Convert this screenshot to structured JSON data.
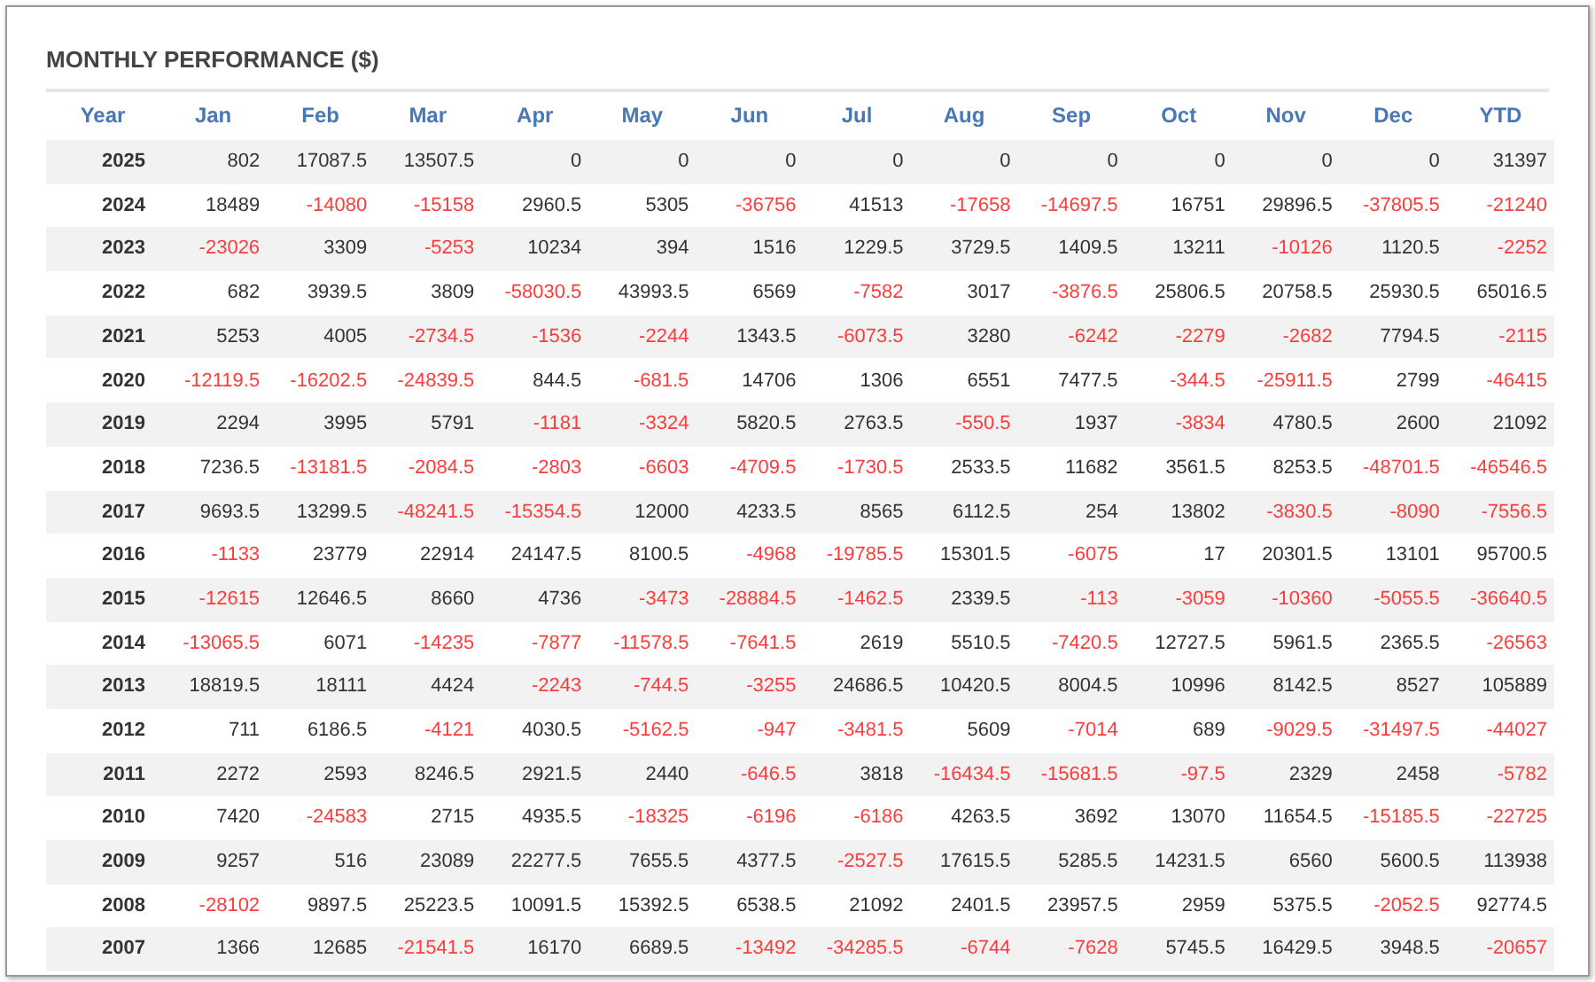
{
  "title": "MONTHLY PERFORMANCE ($)",
  "columns": [
    "Year",
    "Jan",
    "Feb",
    "Mar",
    "Apr",
    "May",
    "Jun",
    "Jul",
    "Aug",
    "Sep",
    "Oct",
    "Nov",
    "Dec",
    "YTD"
  ],
  "rows": [
    {
      "year": "2025",
      "cells": [
        {
          "value": "802",
          "negative": false
        },
        {
          "value": "17087.5",
          "negative": false
        },
        {
          "value": "13507.5",
          "negative": false
        },
        {
          "value": "0",
          "negative": false
        },
        {
          "value": "0",
          "negative": false
        },
        {
          "value": "0",
          "negative": false
        },
        {
          "value": "0",
          "negative": false
        },
        {
          "value": "0",
          "negative": false
        },
        {
          "value": "0",
          "negative": false
        },
        {
          "value": "0",
          "negative": false
        },
        {
          "value": "0",
          "negative": false
        },
        {
          "value": "0",
          "negative": false
        },
        {
          "value": "31397",
          "negative": false
        }
      ]
    },
    {
      "year": "2024",
      "cells": [
        {
          "value": "18489",
          "negative": false
        },
        {
          "value": "-14080",
          "negative": true
        },
        {
          "value": "-15158",
          "negative": true
        },
        {
          "value": "2960.5",
          "negative": false
        },
        {
          "value": "5305",
          "negative": false
        },
        {
          "value": "-36756",
          "negative": true
        },
        {
          "value": "41513",
          "negative": false
        },
        {
          "value": "-17658",
          "negative": true
        },
        {
          "value": "-14697.5",
          "negative": true
        },
        {
          "value": "16751",
          "negative": false
        },
        {
          "value": "29896.5",
          "negative": false
        },
        {
          "value": "-37805.5",
          "negative": true
        },
        {
          "value": "-21240",
          "negative": true
        }
      ]
    },
    {
      "year": "2023",
      "cells": [
        {
          "value": "-23026",
          "negative": true
        },
        {
          "value": "3309",
          "negative": false
        },
        {
          "value": "-5253",
          "negative": true
        },
        {
          "value": "10234",
          "negative": false
        },
        {
          "value": "394",
          "negative": false
        },
        {
          "value": "1516",
          "negative": false
        },
        {
          "value": "1229.5",
          "negative": false
        },
        {
          "value": "3729.5",
          "negative": false
        },
        {
          "value": "1409.5",
          "negative": false
        },
        {
          "value": "13211",
          "negative": false
        },
        {
          "value": "-10126",
          "negative": true
        },
        {
          "value": "1120.5",
          "negative": false
        },
        {
          "value": "-2252",
          "negative": true
        }
      ]
    },
    {
      "year": "2022",
      "cells": [
        {
          "value": "682",
          "negative": false
        },
        {
          "value": "3939.5",
          "negative": false
        },
        {
          "value": "3809",
          "negative": false
        },
        {
          "value": "-58030.5",
          "negative": true
        },
        {
          "value": "43993.5",
          "negative": false
        },
        {
          "value": "6569",
          "negative": false
        },
        {
          "value": "-7582",
          "negative": true
        },
        {
          "value": "3017",
          "negative": false
        },
        {
          "value": "-3876.5",
          "negative": true
        },
        {
          "value": "25806.5",
          "negative": false
        },
        {
          "value": "20758.5",
          "negative": false
        },
        {
          "value": "25930.5",
          "negative": false
        },
        {
          "value": "65016.5",
          "negative": false
        }
      ]
    },
    {
      "year": "2021",
      "cells": [
        {
          "value": "5253",
          "negative": false
        },
        {
          "value": "4005",
          "negative": false
        },
        {
          "value": "-2734.5",
          "negative": true
        },
        {
          "value": "-1536",
          "negative": true
        },
        {
          "value": "-2244",
          "negative": true
        },
        {
          "value": "1343.5",
          "negative": false
        },
        {
          "value": "-6073.5",
          "negative": true
        },
        {
          "value": "3280",
          "negative": false
        },
        {
          "value": "-6242",
          "negative": true
        },
        {
          "value": "-2279",
          "negative": true
        },
        {
          "value": "-2682",
          "negative": true
        },
        {
          "value": "7794.5",
          "negative": false
        },
        {
          "value": "-2115",
          "negative": true
        }
      ]
    },
    {
      "year": "2020",
      "cells": [
        {
          "value": "-12119.5",
          "negative": true
        },
        {
          "value": "-16202.5",
          "negative": true
        },
        {
          "value": "-24839.5",
          "negative": true
        },
        {
          "value": "844.5",
          "negative": false
        },
        {
          "value": "-681.5",
          "negative": true
        },
        {
          "value": "14706",
          "negative": false
        },
        {
          "value": "1306",
          "negative": false
        },
        {
          "value": "6551",
          "negative": false
        },
        {
          "value": "7477.5",
          "negative": false
        },
        {
          "value": "-344.5",
          "negative": true
        },
        {
          "value": "-25911.5",
          "negative": true
        },
        {
          "value": "2799",
          "negative": false
        },
        {
          "value": "-46415",
          "negative": true
        }
      ]
    },
    {
      "year": "2019",
      "cells": [
        {
          "value": "2294",
          "negative": false
        },
        {
          "value": "3995",
          "negative": false
        },
        {
          "value": "5791",
          "negative": false
        },
        {
          "value": "-1181",
          "negative": true
        },
        {
          "value": "-3324",
          "negative": true
        },
        {
          "value": "5820.5",
          "negative": false
        },
        {
          "value": "2763.5",
          "negative": false
        },
        {
          "value": "-550.5",
          "negative": true
        },
        {
          "value": "1937",
          "negative": false
        },
        {
          "value": "-3834",
          "negative": true
        },
        {
          "value": "4780.5",
          "negative": false
        },
        {
          "value": "2600",
          "negative": false
        },
        {
          "value": "21092",
          "negative": false
        }
      ]
    },
    {
      "year": "2018",
      "cells": [
        {
          "value": "7236.5",
          "negative": false
        },
        {
          "value": "-13181.5",
          "negative": true
        },
        {
          "value": "-2084.5",
          "negative": true
        },
        {
          "value": "-2803",
          "negative": true
        },
        {
          "value": "-6603",
          "negative": true
        },
        {
          "value": "-4709.5",
          "negative": true
        },
        {
          "value": "-1730.5",
          "negative": true
        },
        {
          "value": "2533.5",
          "negative": false
        },
        {
          "value": "11682",
          "negative": false
        },
        {
          "value": "3561.5",
          "negative": false
        },
        {
          "value": "8253.5",
          "negative": false
        },
        {
          "value": "-48701.5",
          "negative": true
        },
        {
          "value": "-46546.5",
          "negative": true
        }
      ]
    },
    {
      "year": "2017",
      "cells": [
        {
          "value": "9693.5",
          "negative": false
        },
        {
          "value": "13299.5",
          "negative": false
        },
        {
          "value": "-48241.5",
          "negative": true
        },
        {
          "value": "-15354.5",
          "negative": true
        },
        {
          "value": "12000",
          "negative": false
        },
        {
          "value": "4233.5",
          "negative": false
        },
        {
          "value": "8565",
          "negative": false
        },
        {
          "value": "6112.5",
          "negative": false
        },
        {
          "value": "254",
          "negative": false
        },
        {
          "value": "13802",
          "negative": false
        },
        {
          "value": "-3830.5",
          "negative": true
        },
        {
          "value": "-8090",
          "negative": true
        },
        {
          "value": "-7556.5",
          "negative": true
        }
      ]
    },
    {
      "year": "2016",
      "cells": [
        {
          "value": "-1133",
          "negative": true
        },
        {
          "value": "23779",
          "negative": false
        },
        {
          "value": "22914",
          "negative": false
        },
        {
          "value": "24147.5",
          "negative": false
        },
        {
          "value": "8100.5",
          "negative": false
        },
        {
          "value": "-4968",
          "negative": true
        },
        {
          "value": "-19785.5",
          "negative": true
        },
        {
          "value": "15301.5",
          "negative": false
        },
        {
          "value": "-6075",
          "negative": true
        },
        {
          "value": "17",
          "negative": false
        },
        {
          "value": "20301.5",
          "negative": false
        },
        {
          "value": "13101",
          "negative": false
        },
        {
          "value": "95700.5",
          "negative": false
        }
      ]
    },
    {
      "year": "2015",
      "cells": [
        {
          "value": "-12615",
          "negative": true
        },
        {
          "value": "12646.5",
          "negative": false
        },
        {
          "value": "8660",
          "negative": false
        },
        {
          "value": "4736",
          "negative": false
        },
        {
          "value": "-3473",
          "negative": true
        },
        {
          "value": "-28884.5",
          "negative": true
        },
        {
          "value": "-1462.5",
          "negative": true
        },
        {
          "value": "2339.5",
          "negative": false
        },
        {
          "value": "-113",
          "negative": true
        },
        {
          "value": "-3059",
          "negative": true
        },
        {
          "value": "-10360",
          "negative": true
        },
        {
          "value": "-5055.5",
          "negative": true
        },
        {
          "value": "-36640.5",
          "negative": true
        }
      ]
    },
    {
      "year": "2014",
      "cells": [
        {
          "value": "-13065.5",
          "negative": true
        },
        {
          "value": "6071",
          "negative": false
        },
        {
          "value": "-14235",
          "negative": true
        },
        {
          "value": "-7877",
          "negative": true
        },
        {
          "value": "-11578.5",
          "negative": true
        },
        {
          "value": "-7641.5",
          "negative": true
        },
        {
          "value": "2619",
          "negative": false
        },
        {
          "value": "5510.5",
          "negative": false
        },
        {
          "value": "-7420.5",
          "negative": true
        },
        {
          "value": "12727.5",
          "negative": false
        },
        {
          "value": "5961.5",
          "negative": false
        },
        {
          "value": "2365.5",
          "negative": false
        },
        {
          "value": "-26563",
          "negative": true
        }
      ]
    },
    {
      "year": "2013",
      "cells": [
        {
          "value": "18819.5",
          "negative": false
        },
        {
          "value": "18111",
          "negative": false
        },
        {
          "value": "4424",
          "negative": false
        },
        {
          "value": "-2243",
          "negative": true
        },
        {
          "value": "-744.5",
          "negative": true
        },
        {
          "value": "-3255",
          "negative": true
        },
        {
          "value": "24686.5",
          "negative": false
        },
        {
          "value": "10420.5",
          "negative": false
        },
        {
          "value": "8004.5",
          "negative": false
        },
        {
          "value": "10996",
          "negative": false
        },
        {
          "value": "8142.5",
          "negative": false
        },
        {
          "value": "8527",
          "negative": false
        },
        {
          "value": "105889",
          "negative": false
        }
      ]
    },
    {
      "year": "2012",
      "cells": [
        {
          "value": "711",
          "negative": false
        },
        {
          "value": "6186.5",
          "negative": false
        },
        {
          "value": "-4121",
          "negative": true
        },
        {
          "value": "4030.5",
          "negative": false
        },
        {
          "value": "-5162.5",
          "negative": true
        },
        {
          "value": "-947",
          "negative": true
        },
        {
          "value": "-3481.5",
          "negative": true
        },
        {
          "value": "5609",
          "negative": false
        },
        {
          "value": "-7014",
          "negative": true
        },
        {
          "value": "689",
          "negative": false
        },
        {
          "value": "-9029.5",
          "negative": true
        },
        {
          "value": "-31497.5",
          "negative": true
        },
        {
          "value": "-44027",
          "negative": true
        }
      ]
    },
    {
      "year": "2011",
      "cells": [
        {
          "value": "2272",
          "negative": false
        },
        {
          "value": "2593",
          "negative": false
        },
        {
          "value": "8246.5",
          "negative": false
        },
        {
          "value": "2921.5",
          "negative": false
        },
        {
          "value": "2440",
          "negative": false
        },
        {
          "value": "-646.5",
          "negative": true
        },
        {
          "value": "3818",
          "negative": false
        },
        {
          "value": "-16434.5",
          "negative": true
        },
        {
          "value": "-15681.5",
          "negative": true
        },
        {
          "value": "-97.5",
          "negative": true
        },
        {
          "value": "2329",
          "negative": false
        },
        {
          "value": "2458",
          "negative": false
        },
        {
          "value": "-5782",
          "negative": true
        }
      ]
    },
    {
      "year": "2010",
      "cells": [
        {
          "value": "7420",
          "negative": false
        },
        {
          "value": "-24583",
          "negative": true
        },
        {
          "value": "2715",
          "negative": false
        },
        {
          "value": "4935.5",
          "negative": false
        },
        {
          "value": "-18325",
          "negative": true
        },
        {
          "value": "-6196",
          "negative": true
        },
        {
          "value": "-6186",
          "negative": true
        },
        {
          "value": "4263.5",
          "negative": false
        },
        {
          "value": "3692",
          "negative": false
        },
        {
          "value": "13070",
          "negative": false
        },
        {
          "value": "11654.5",
          "negative": false
        },
        {
          "value": "-15185.5",
          "negative": true
        },
        {
          "value": "-22725",
          "negative": true
        }
      ]
    },
    {
      "year": "2009",
      "cells": [
        {
          "value": "9257",
          "negative": false
        },
        {
          "value": "516",
          "negative": false
        },
        {
          "value": "23089",
          "negative": false
        },
        {
          "value": "22277.5",
          "negative": false
        },
        {
          "value": "7655.5",
          "negative": false
        },
        {
          "value": "4377.5",
          "negative": false
        },
        {
          "value": "-2527.5",
          "negative": true
        },
        {
          "value": "17615.5",
          "negative": false
        },
        {
          "value": "5285.5",
          "negative": false
        },
        {
          "value": "14231.5",
          "negative": false
        },
        {
          "value": "6560",
          "negative": false
        },
        {
          "value": "5600.5",
          "negative": false
        },
        {
          "value": "113938",
          "negative": false
        }
      ]
    },
    {
      "year": "2008",
      "cells": [
        {
          "value": "-28102",
          "negative": true
        },
        {
          "value": "9897.5",
          "negative": false
        },
        {
          "value": "25223.5",
          "negative": false
        },
        {
          "value": "10091.5",
          "negative": false
        },
        {
          "value": "15392.5",
          "negative": false
        },
        {
          "value": "6538.5",
          "negative": false
        },
        {
          "value": "21092",
          "negative": false
        },
        {
          "value": "2401.5",
          "negative": false
        },
        {
          "value": "23957.5",
          "negative": false
        },
        {
          "value": "2959",
          "negative": false
        },
        {
          "value": "5375.5",
          "negative": false
        },
        {
          "value": "-2052.5",
          "negative": true
        },
        {
          "value": "92774.5",
          "negative": false
        }
      ]
    },
    {
      "year": "2007",
      "cells": [
        {
          "value": "1366",
          "negative": false
        },
        {
          "value": "12685",
          "negative": false
        },
        {
          "value": "-21541.5",
          "negative": true
        },
        {
          "value": "16170",
          "negative": false
        },
        {
          "value": "6689.5",
          "negative": false
        },
        {
          "value": "-13492",
          "negative": true
        },
        {
          "value": "-34285.5",
          "negative": true
        },
        {
          "value": "-6744",
          "negative": true
        },
        {
          "value": "-7628",
          "negative": true
        },
        {
          "value": "5745.5",
          "negative": false
        },
        {
          "value": "16429.5",
          "negative": false
        },
        {
          "value": "3948.5",
          "negative": false
        },
        {
          "value": "-20657",
          "negative": true
        }
      ]
    }
  ]
}
